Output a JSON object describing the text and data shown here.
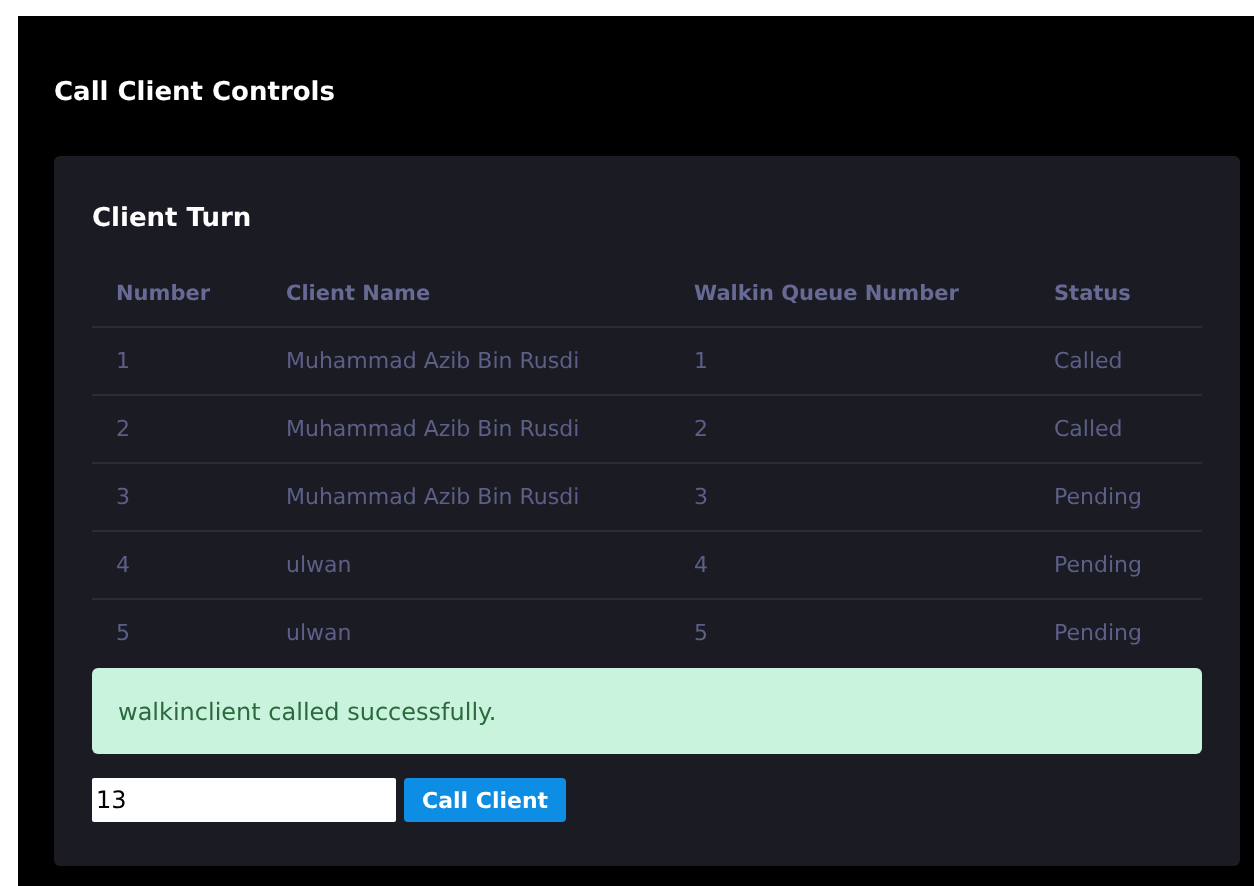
{
  "page": {
    "title": "Call Client Controls"
  },
  "card": {
    "title": "Client Turn",
    "table": {
      "columns": [
        "Number",
        "Client Name",
        "Walkin Queue Number",
        "Status"
      ],
      "rows": [
        [
          "1",
          "Muhammad Azib Bin Rusdi",
          "1",
          "Called"
        ],
        [
          "2",
          "Muhammad Azib Bin Rusdi",
          "2",
          "Called"
        ],
        [
          "3",
          "Muhammad Azib Bin Rusdi",
          "3",
          "Pending"
        ],
        [
          "4",
          "ulwan",
          "4",
          "Pending"
        ],
        [
          "5",
          "ulwan",
          "5",
          "Pending"
        ]
      ]
    },
    "alert": {
      "message": "walkinclient called successfully."
    },
    "input": {
      "value": "13"
    },
    "button": "Call Client"
  }
}
